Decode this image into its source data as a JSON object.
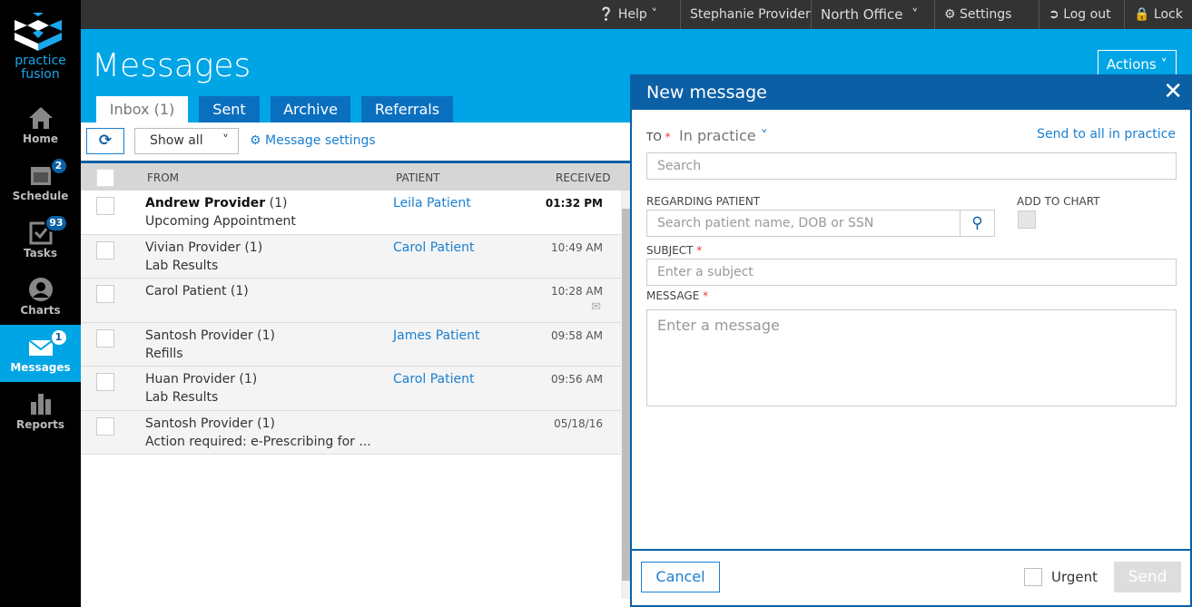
{
  "brand": {
    "name": "practice fusion",
    "color": "#00a5e6"
  },
  "sidebar": {
    "items": [
      {
        "label": "Home",
        "icon": "home-icon",
        "badge": null
      },
      {
        "label": "Schedule",
        "icon": "calendar-icon",
        "badge": "2"
      },
      {
        "label": "Tasks",
        "icon": "tasks-icon",
        "badge": "93"
      },
      {
        "label": "Charts",
        "icon": "person-icon",
        "badge": null
      },
      {
        "label": "Messages",
        "icon": "envelope-icon",
        "badge": "1"
      },
      {
        "label": "Reports",
        "icon": "bar-chart-icon",
        "badge": null
      }
    ]
  },
  "topbar": {
    "help": "Help",
    "user": "Stephanie Provider",
    "office": "North Office",
    "settings": "Settings",
    "logout": "Log out",
    "lock": "Lock"
  },
  "page": {
    "title": "Messages",
    "actions": "Actions"
  },
  "tabs": [
    "Inbox (1)",
    "Sent",
    "Archive",
    "Referrals"
  ],
  "toolbar": {
    "filter": "Show all",
    "settings": "Message settings"
  },
  "table": {
    "headers": [
      "FROM",
      "PATIENT",
      "RECEIVED"
    ],
    "rows": [
      {
        "from": "Andrew Provider",
        "count": " (1)",
        "subject": "Upcoming Appointment",
        "patient": "Leila Patient",
        "received": "01:32 PM",
        "unread": true
      },
      {
        "from": "Vivian Provider",
        "count": " (1)",
        "subject": "Lab Results",
        "patient": "Carol Patient",
        "received": "10:49 AM"
      },
      {
        "from": "Carol Patient",
        "count": " (1)",
        "subject": "",
        "patient": "",
        "received": "10:28 AM",
        "secure": true
      },
      {
        "from": "Santosh Provider",
        "count": " (1)",
        "subject": "Refills",
        "patient": "James Patient",
        "received": "09:58 AM"
      },
      {
        "from": "Huan Provider",
        "count": " (1)",
        "subject": "Lab Results",
        "patient": "Carol Patient",
        "received": "09:56 AM"
      },
      {
        "from": "Santosh Provider",
        "count": " (1)",
        "subject": "Action required: e-Prescribing for ...",
        "patient": "",
        "received": "05/18/16"
      }
    ]
  },
  "modal": {
    "title": "New message",
    "to_label": "TO",
    "to_scope": "In practice",
    "send_all": "Send to all in practice",
    "search_ph": "Search",
    "regarding_label": "REGARDING PATIENT",
    "regarding_ph": "Search patient name, DOB or SSN",
    "add_chart": "ADD TO CHART",
    "subject_label": "SUBJECT",
    "subject_ph": "Enter a subject",
    "message_label": "MESSAGE",
    "message_ph": "Enter a message",
    "required": "*",
    "cancel": "Cancel",
    "urgent": "Urgent",
    "send": "Send"
  }
}
